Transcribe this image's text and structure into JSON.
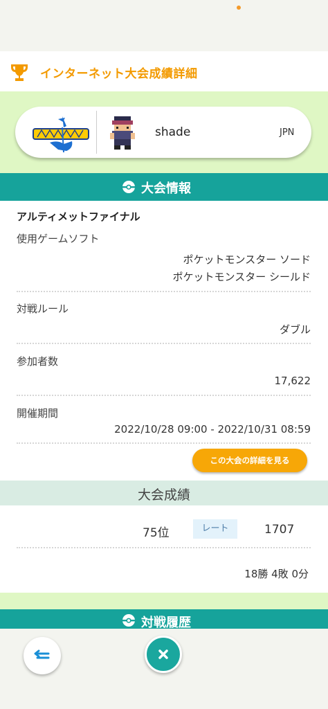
{
  "header": {
    "title": "インターネット大会成績詳細",
    "icon": "trophy-icon"
  },
  "player_card": {
    "game_logo": "ポケットモンスター ソード",
    "player_name": "shade",
    "country": "JPN"
  },
  "info_section": {
    "title": "大会情報",
    "competition_name": "アルティメットファイナル",
    "software_label": "使用ゲームソフト",
    "software_values": [
      "ポケットモンスター ソード",
      "ポケットモンスター シールド"
    ],
    "rule_label": "対戦ルール",
    "rule_value": "ダブル",
    "participants_label": "参加者数",
    "participants_value": "17,622",
    "period_label": "開催期間",
    "period_value": "2022/10/28 09:00 - 2022/10/31 08:59",
    "details_button": "この大会の詳細を見る"
  },
  "results": {
    "title": "大会成績",
    "rank": "75位",
    "rate_label": "レート",
    "rating": "1707",
    "record": "18勝 4敗 0分"
  },
  "battle_history": {
    "title": "対戦履歴"
  },
  "colors": {
    "accent": "#16a39b",
    "orange": "#f7a707",
    "light_green": "#dff7c4"
  }
}
